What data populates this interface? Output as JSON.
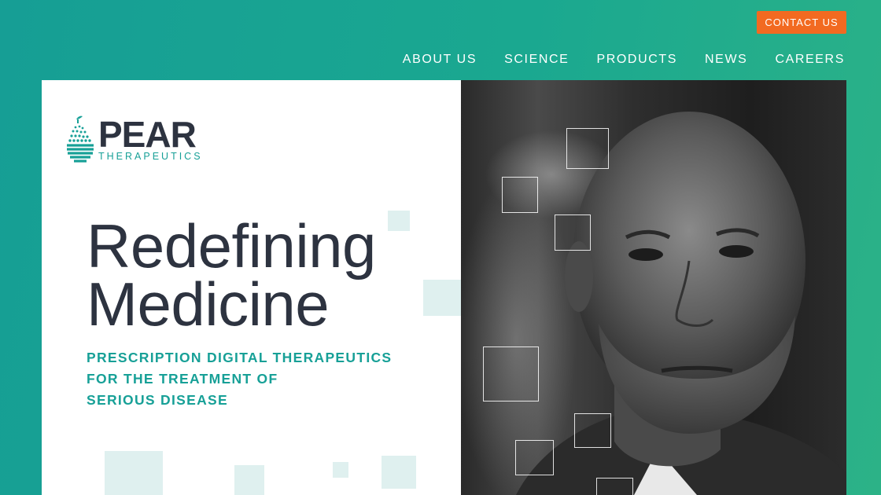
{
  "header": {
    "contact_label": "CONTACT US",
    "nav": [
      "ABOUT US",
      "SCIENCE",
      "PRODUCTS",
      "NEWS",
      "CAREERS"
    ]
  },
  "logo": {
    "word": "PEAR",
    "sub": "THERAPEUTICS",
    "icon": "pear-icon"
  },
  "hero": {
    "headline_line1": "Redefining",
    "headline_line2": "Medicine",
    "subhead_line1": "PRESCRIPTION DIGITAL THERAPEUTICS",
    "subhead_line2": "FOR THE TREATMENT OF",
    "subhead_line3": "SERIOUS DISEASE"
  },
  "photo": {
    "subject": "portrait-photo"
  },
  "colors": {
    "teal": "#17a097",
    "orange": "#f26a21",
    "dark_text": "#2d3340",
    "light_square": "#dff0ef"
  }
}
